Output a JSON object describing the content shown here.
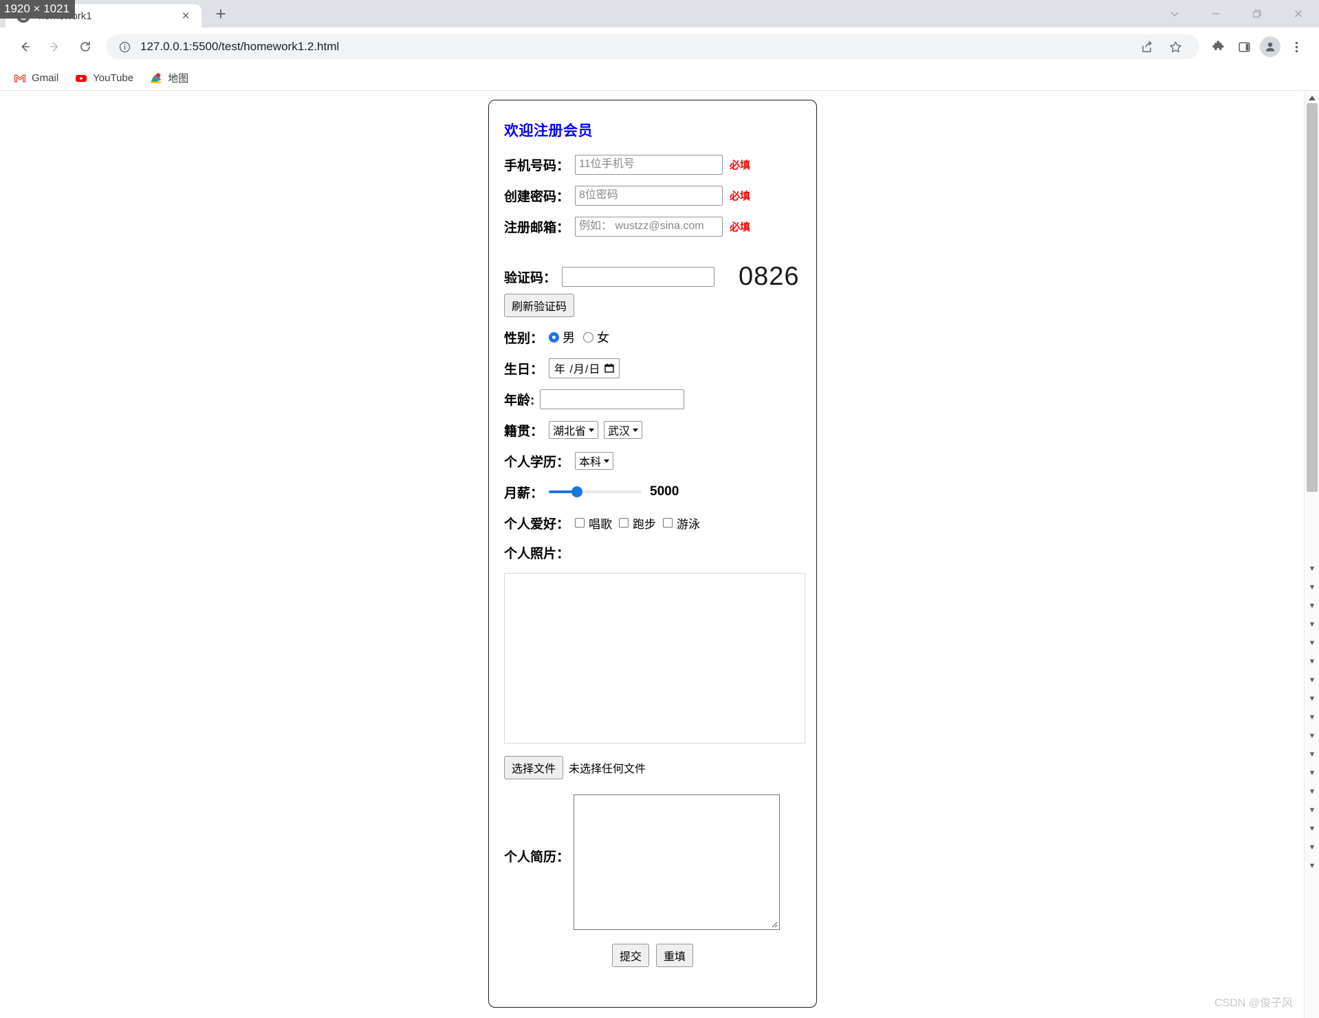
{
  "window": {
    "resolution_badge": "1920 × 1021",
    "controls": {
      "tab_search": "chevron-down",
      "minimize": "minimize",
      "restore": "restore",
      "close": "close"
    }
  },
  "browser": {
    "tab": {
      "title": "homework1",
      "close_label": "×"
    },
    "new_tab_label": "+",
    "nav": {
      "back": "←",
      "forward": "→",
      "reload": "↻"
    },
    "omnibox": {
      "url": "127.0.0.1:5500/test/homework1.2.html",
      "info_icon": "info-circle-icon",
      "share_icon": "share-icon",
      "bookmark_icon": "star-icon"
    },
    "toolbar_icons": {
      "extensions": "puzzle-icon",
      "side_panel": "side-panel-icon",
      "profile": "profile-avatar-icon",
      "menu": "three-dot-menu-icon"
    },
    "bookmarks": [
      {
        "label": "Gmail",
        "icon": "gmail-icon"
      },
      {
        "label": "YouTube",
        "icon": "youtube-icon"
      },
      {
        "label": "地图",
        "icon": "google-maps-icon"
      }
    ]
  },
  "form": {
    "title": "欢迎注册会员",
    "required_badge": "必填",
    "phone": {
      "label": "手机号码：",
      "placeholder": "11位手机号",
      "value": ""
    },
    "password": {
      "label": "创建密码：",
      "placeholder": "8位密码",
      "value": ""
    },
    "email": {
      "label": "注册邮箱：",
      "placeholder": "例如： wustzz@sina.com",
      "value": ""
    },
    "captcha": {
      "label": "验证码：",
      "value": "",
      "code": "0826",
      "refresh_label": "刷新验证码"
    },
    "gender": {
      "label": "性别：",
      "options": [
        {
          "label": "男",
          "selected": true
        },
        {
          "label": "女",
          "selected": false
        }
      ]
    },
    "birthday": {
      "label": "生日：",
      "placeholder": "年 /月/日",
      "value": ""
    },
    "age": {
      "label": "年龄:",
      "value": ""
    },
    "hometown": {
      "label": "籍贯：",
      "province": "湖北省",
      "city": "武汉"
    },
    "education": {
      "label": "个人学历：",
      "value": "本科"
    },
    "salary": {
      "label": "月薪：",
      "value": "5000",
      "percent": 30
    },
    "hobbies": {
      "label": "个人爱好：",
      "options": [
        {
          "label": "唱歌",
          "checked": false
        },
        {
          "label": "跑步",
          "checked": false
        },
        {
          "label": "游泳",
          "checked": false
        }
      ]
    },
    "photo": {
      "label": "个人照片：",
      "choose_label": "选择文件",
      "file_status": "未选择任何文件"
    },
    "resume": {
      "label": "个人简历：",
      "value": ""
    },
    "actions": {
      "submit": "提交",
      "reset": "重填"
    }
  },
  "watermark": "CSDN @俊子风"
}
